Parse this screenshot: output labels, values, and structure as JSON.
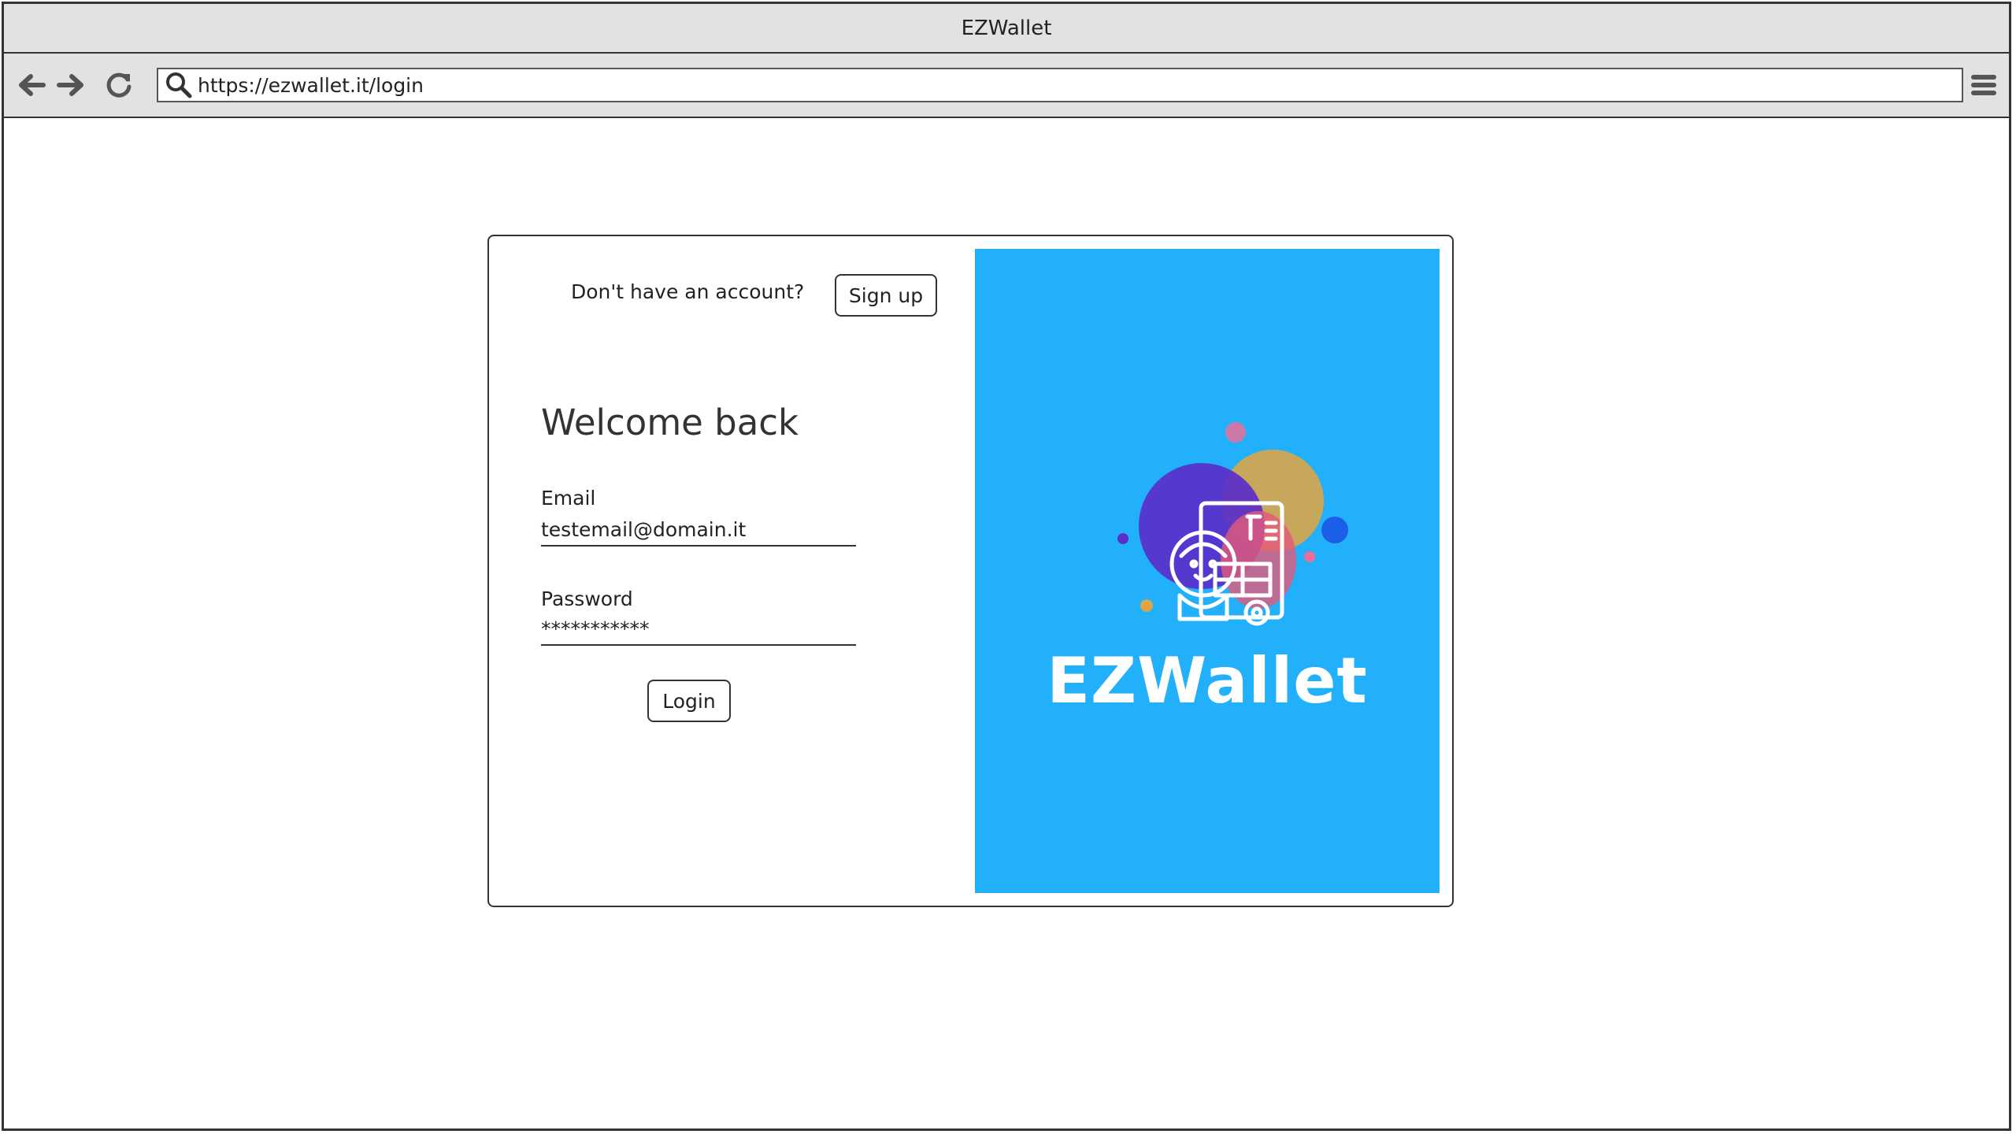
{
  "window": {
    "title": "EZWallet"
  },
  "browser": {
    "url": "https://ezwallet.it/login",
    "back_icon": "arrow-left-icon",
    "forward_icon": "arrow-right-icon",
    "reload_icon": "reload-icon",
    "menu_icon": "hamburger-menu-icon"
  },
  "auth": {
    "no_account_text": "Don't have an account?",
    "signup_label": "Sign up",
    "heading": "Welcome back",
    "email_label": "Email",
    "email_value": "testemail@domain.it",
    "password_label": "Password",
    "password_value": "***********",
    "login_label": "Login"
  },
  "promo": {
    "brand_name": "EZWallet",
    "background_color": "#22b0fb"
  }
}
